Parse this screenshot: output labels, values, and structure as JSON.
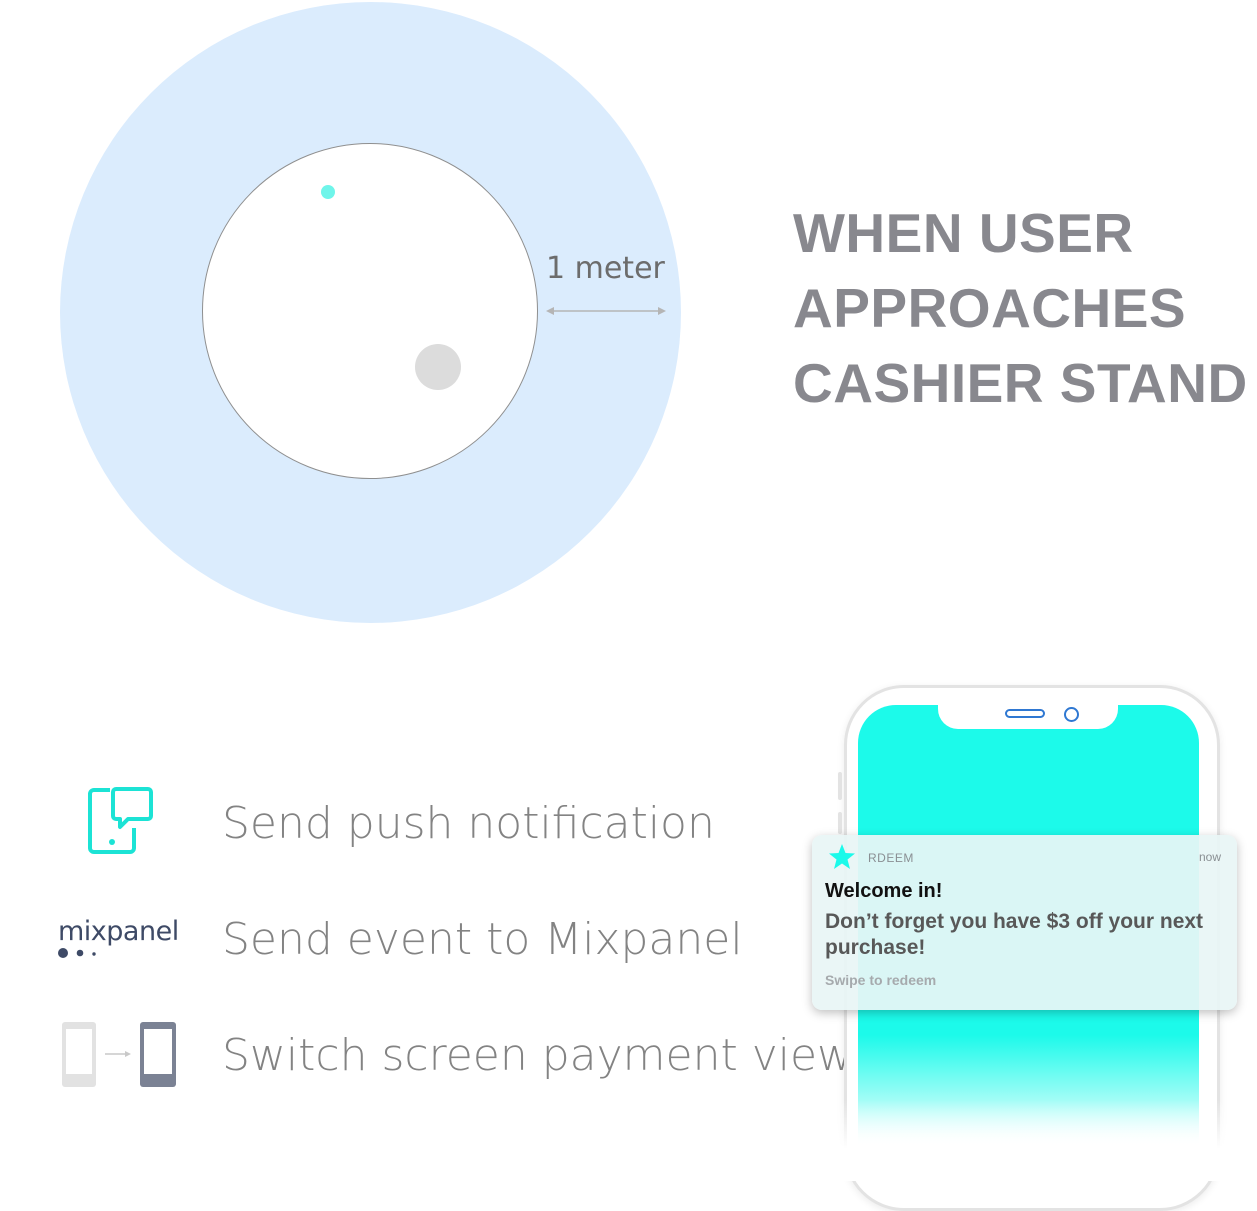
{
  "diagram": {
    "distance_label": "1 meter",
    "headline": [
      "WHEN USER",
      "APPROACHES",
      "CASHIER STAND"
    ]
  },
  "actions": [
    {
      "label": "Send push notification",
      "icon": "push-notification-icon"
    },
    {
      "label": "Send event to Mixpanel",
      "icon": "mixpanel-logo"
    },
    {
      "label": "Switch screen payment view",
      "icon": "switch-screen-icon"
    }
  ],
  "mixpanel_logo_text": "mixpanel",
  "notification": {
    "app_name": "RDEEM",
    "time": "now",
    "title": "Welcome in!",
    "body": "Don’t forget you have $3 off your next purchase!",
    "footer": "Swipe to redeem"
  },
  "colors": {
    "zone": "#dbecfd",
    "accent": "#1cfaea",
    "text_gray": "#838383",
    "headline_gray": "#88888e"
  }
}
